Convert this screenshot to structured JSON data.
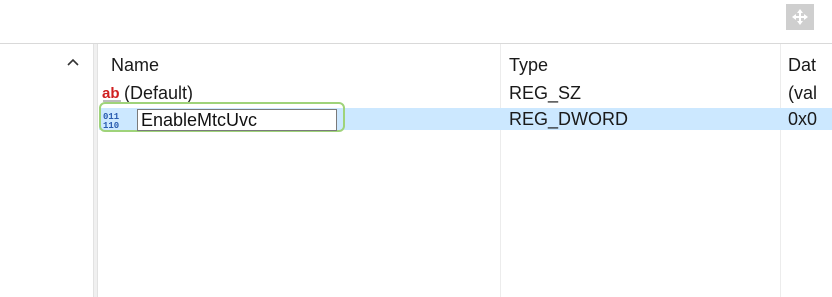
{
  "columns": {
    "name": "Name",
    "type": "Type",
    "data": "Dat"
  },
  "rows": [
    {
      "icon": "string-value-icon",
      "name": "(Default)",
      "type": "REG_SZ",
      "data": "(val"
    },
    {
      "icon": "binary-value-icon",
      "name": "EnableMtcUvc",
      "type": "REG_DWORD",
      "data": "0x0"
    }
  ],
  "icons": {
    "move": "move-arrows-icon",
    "tree_scroll": "chevron-up-icon",
    "string_glyph": "ab",
    "binary_glyph_top": "011",
    "binary_glyph_bottom": "110"
  },
  "colors": {
    "selection": "#cce8ff",
    "rename_highlight": "#9fd37a",
    "string_icon_red": "#d02020",
    "binary_icon_blue": "#2a5db0"
  }
}
